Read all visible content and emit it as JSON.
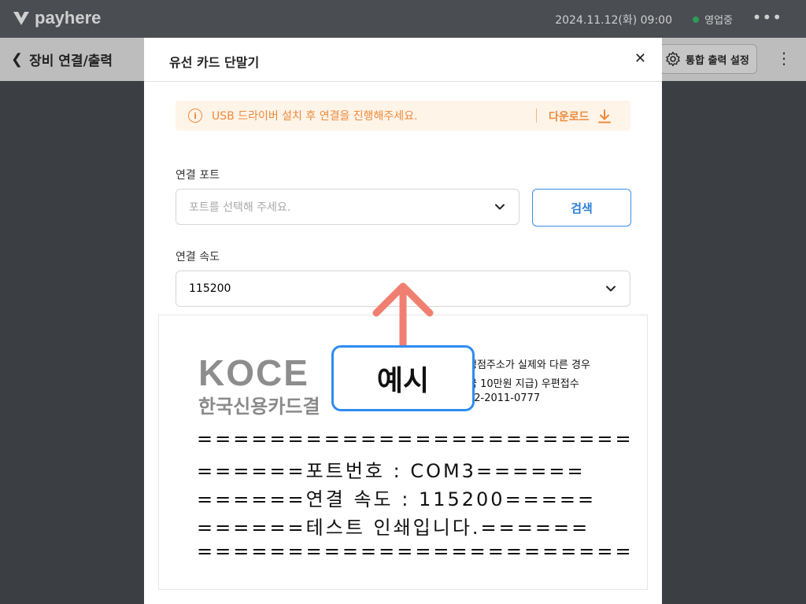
{
  "app": {
    "logo_text": "payhere",
    "datetime": "2024.11.12(화) 09:00",
    "status": "영업중"
  },
  "page": {
    "back_title": "장비 연결/출력",
    "settings_label": "통합 출력 설정"
  },
  "modal": {
    "title": "유선 카드 단말기",
    "notice": {
      "message": "USB 드라이버 설치 후 연결을 진행해주세요.",
      "download_label": "다운로드"
    },
    "port": {
      "label": "연결 포트",
      "placeholder": "포트를 선택해 주세요.",
      "search_label": "검색"
    },
    "speed": {
      "label": "연결 속도",
      "value": "115200"
    }
  },
  "receipt": {
    "brand": "KOCE",
    "brand_sub": "한국신용카드결",
    "notice_lines": [
      "행점주소가 실제와 다른 경우",
      "금 10만원 지급) 우편접수",
      "02-2011-0777"
    ],
    "lines": [
      "========================",
      "======포트번호 : COM3======",
      "======연결 속도 : 115200=====",
      "======테스트 인쇄입니다.======",
      "========================"
    ]
  },
  "overlay": {
    "example_label": "예시"
  },
  "colors": {
    "accent": "#3a8ee6",
    "notice_text": "#ef8a3a",
    "notice_bg": "#fff4e8",
    "status_green": "#2e9b59",
    "arrow": "#f07f72"
  }
}
